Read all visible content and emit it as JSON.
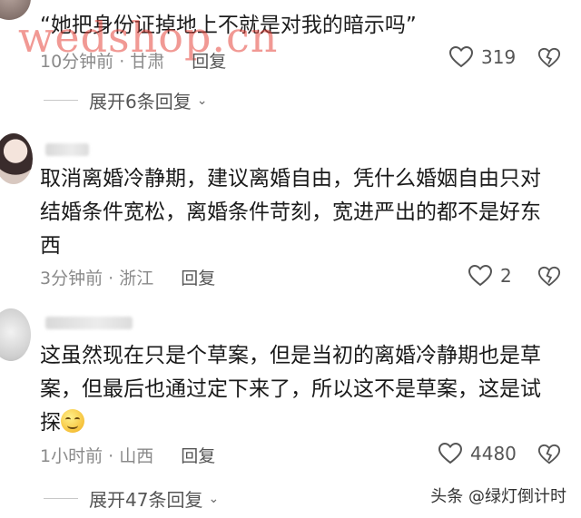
{
  "watermark_top": "wedshop.cn",
  "top_comment": {
    "text": "“她把身份证掉地上不就是对我的暗示吗”",
    "time": "10分钟前 · 甘肃",
    "reply_label": "回复",
    "likes": "319",
    "expand_label": "展开6条回复"
  },
  "comments": [
    {
      "text_lines": [
        "取消离婚冷静期，建议离婚自由，凭什么婚姻自由只对",
        "结婚条件宽松，离婚条件苛刻，宽进严出的都不是好东",
        "西"
      ],
      "time": "3分钟前 · 浙江",
      "reply_label": "回复",
      "likes": "2"
    },
    {
      "text_lines": [
        "这虽然现在只是个草案，但是当初的离婚冷静期也是草",
        "案，但最后也通过定下来了，所以这不是草案，这是试",
        "探"
      ],
      "time": "1小时前 · 山西",
      "reply_label": "回复",
      "likes": "4480",
      "expand_label": "展开47条回复"
    }
  ],
  "brand_watermark": "头条 @绿灯倒计时",
  "icons": {
    "like": "heart-outline-icon",
    "dislike": "broken-heart-icon",
    "expand": "chevron-down-icon"
  },
  "colors": {
    "text": "#1a1a1a",
    "meta": "#8a8a8a",
    "watermark": "#e6463c"
  }
}
